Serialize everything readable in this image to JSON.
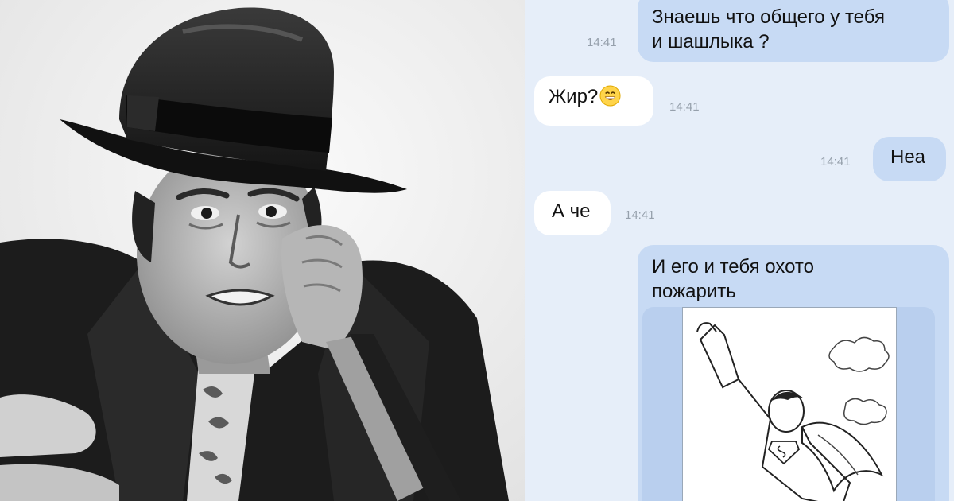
{
  "photo": {
    "subject": "man-in-fedora-portrait",
    "tone": "black-and-white"
  },
  "chat": {
    "colors": {
      "background": "#e6eef9",
      "outgoing_bubble": "#c7daf4",
      "incoming_bubble": "#ffffff",
      "timestamp": "#96a0ac"
    },
    "messages": [
      {
        "direction": "outgoing",
        "lines": [
          "Знаешь что общего у тебя",
          "и шашлыка ?"
        ],
        "time": "14:41"
      },
      {
        "direction": "incoming",
        "text": "Жир?",
        "emoji": "smiling-face-icon",
        "time": "14:41"
      },
      {
        "direction": "outgoing",
        "text": "Неа",
        "time": "14:41"
      },
      {
        "direction": "incoming",
        "text": "А че",
        "time": "14:41"
      },
      {
        "direction": "outgoing",
        "lines": [
          "И его и тебя охото",
          "пожарить"
        ],
        "attachment": "superhero-coloring-page-image"
      }
    ]
  }
}
